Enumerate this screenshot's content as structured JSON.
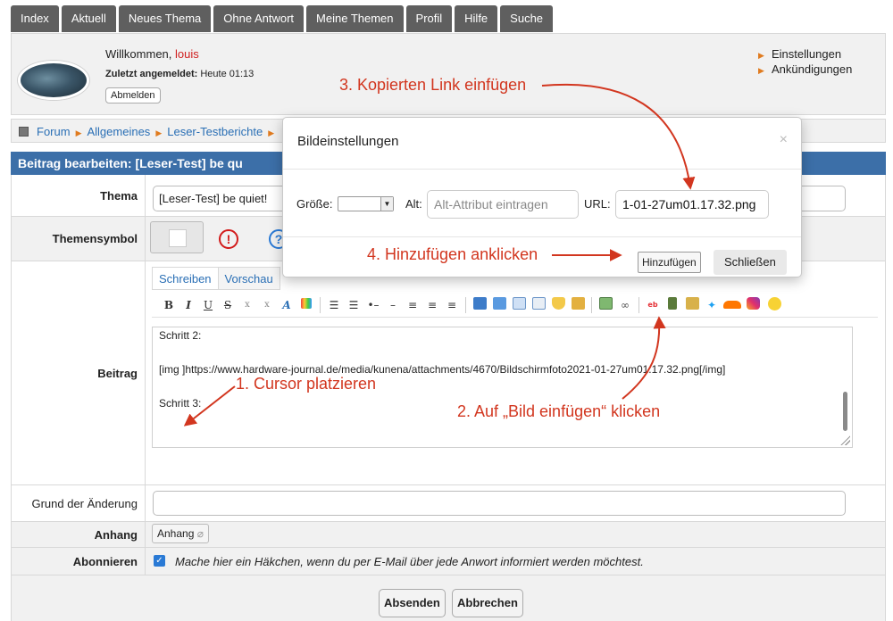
{
  "nav": {
    "tabs": [
      "Index",
      "Aktuell",
      "Neues Thema",
      "Ohne Antwort",
      "Meine Themen",
      "Profil",
      "Hilfe",
      "Suche"
    ]
  },
  "user": {
    "welcome_prefix": "Willkommen, ",
    "name": "louis",
    "last_login_label": "Zuletzt angemeldet:",
    "last_login_value": " Heute 01:13",
    "logout_label": "Abmelden"
  },
  "usermenu": {
    "items": [
      "Einstellungen",
      "Ankündigungen"
    ]
  },
  "breadcrumb": {
    "items": [
      "Forum",
      "Allgemeines",
      "Leser-Testberichte"
    ]
  },
  "form": {
    "header": "Beitrag bearbeiten: [Leser-Test] be qu",
    "thema_label": "Thema",
    "thema_value": "[Leser-Test] be quiet!",
    "symbol_label": "Themensymbol",
    "beitrag_label": "Beitrag",
    "tab_write": "Schreiben",
    "tab_preview": "Vorschau",
    "editor_lines": [
      "Schritt 2:",
      "[img  ]https://www.hardware-journal.de/media/kunena/attachments/4670/Bildschirmfoto2021-01-27um01.17.32.png[/img]",
      "Schritt 3:"
    ],
    "reason_label": "Grund der Änderung",
    "attach_label": "Anhang",
    "attach_button": "Anhang",
    "subscribe_label": "Abonnieren",
    "subscribe_text": "Mache hier ein Häkchen, wenn du per E-Mail über jede Anwort informiert werden möchtest.",
    "submit_button": "Absenden",
    "cancel_button": "Abbrechen"
  },
  "toolbar": {
    "icons": [
      "bold-icon",
      "italic-icon",
      "underline-icon",
      "strikethrough-icon",
      "subscript-icon",
      "superscript-icon",
      "font-size-icon",
      "color-icon",
      "unordered-list-icon",
      "ordered-list-icon",
      "list-item-icon",
      "horizontal-rule-icon",
      "align-left-icon",
      "align-center-icon",
      "align-right-icon",
      "quote-icon",
      "code-icon",
      "table-icon",
      "hide-icon",
      "spoiler-icon",
      "confidential-icon",
      "insert-image-icon",
      "link-icon",
      "ebay-icon",
      "video-icon",
      "map-icon",
      "twitter-icon",
      "soundcloud-icon",
      "instagram-icon",
      "emoticon-icon"
    ],
    "glyphs": {
      "bold": "B",
      "italic": "I",
      "underline": "U",
      "strike": "S",
      "sub": "x",
      "sup": "x",
      "font": "A"
    }
  },
  "modal": {
    "title": "Bildeinstellungen",
    "close_glyph": "×",
    "size_label": "Größe:",
    "alt_label": "Alt:",
    "alt_placeholder": "Alt-Attribut eintragen",
    "url_label": "URL:",
    "url_value": "1-01-27um01.17.32.png",
    "add_button": "Hinzufügen",
    "close_button": "Schließen"
  },
  "annotations": {
    "step1": "1. Cursor platzieren",
    "step2": "2. Auf „Bild einfügen“ klicken",
    "step3": "3. Kopierten Link einfügen",
    "step4": "4. Hinzufügen anklicken"
  },
  "colors": {
    "tab_bg": "#5f5f5f",
    "header_blue": "#3c6fa8",
    "link_blue": "#2a6fb5",
    "annotation_red": "#d2361f",
    "breadcrumb_arrow": "#e07b1f"
  }
}
